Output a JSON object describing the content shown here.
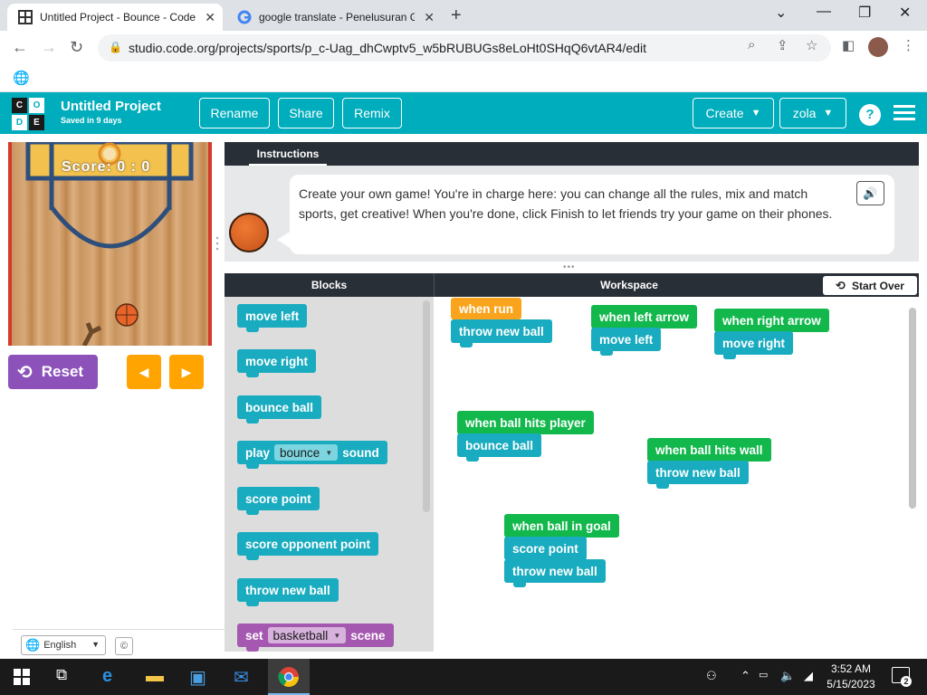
{
  "browser": {
    "tabs": [
      {
        "title": "Untitled Project - Bounce - Code",
        "close": "✕"
      },
      {
        "title": "google translate - Penelusuran G",
        "close": "✕"
      }
    ],
    "new_tab": "+",
    "window_controls": {
      "dropdown": "⌄",
      "minimize": "—",
      "restore": "❐",
      "close": "✕"
    },
    "url": "studio.code.org/projects/sports/p_c-Uag_dhCwptv5_w5bRUBUGs8eLoHt0SHqQ6vtAR4/edit"
  },
  "header": {
    "logo_letters": [
      "C",
      "O",
      "D",
      "E"
    ],
    "project_name": "Untitled Project",
    "saved_status": "Saved in 9 days",
    "rename_label": "Rename",
    "share_label": "Share",
    "remix_label": "Remix",
    "create_label": "Create",
    "user_label": "zola",
    "help_label": "?"
  },
  "game": {
    "score_text": "Score: 0 : 0",
    "reset_label": "Reset",
    "left_arrow": "◀",
    "right_arrow": "▶"
  },
  "footer": {
    "language": "English",
    "copyright": "©"
  },
  "instructions": {
    "tab_label": "Instructions",
    "text": "Create your own game! You're in charge here: you can change all the rules, mix and match sports, get creative! When you're done, click Finish to let friends try your game on their phones."
  },
  "panels": {
    "blocks_label": "Blocks",
    "workspace_label": "Workspace",
    "start_over_label": "Start Over"
  },
  "toolbox": {
    "move_left": "move left",
    "move_right": "move right",
    "bounce_ball": "bounce ball",
    "play_prefix": "play",
    "play_sound_value": "bounce",
    "play_suffix": "sound",
    "score_point": "score point",
    "score_opponent_point": "score opponent point",
    "throw_new_ball": "throw new ball",
    "set_prefix": "set",
    "set_scene_value": "basketball",
    "set_suffix": "scene"
  },
  "workspace": {
    "when_run": {
      "event": "when run",
      "action": "throw new ball"
    },
    "when_left_arrow": {
      "event": "when left arrow",
      "action": "move left"
    },
    "when_right_arrow": {
      "event": "when right arrow",
      "action": "move right"
    },
    "when_ball_hits_player": {
      "event": "when ball hits player",
      "action": "bounce ball"
    },
    "when_ball_hits_wall": {
      "event": "when ball hits wall",
      "action": "throw new ball"
    },
    "when_ball_in_goal": {
      "event": "when ball in goal",
      "actions": [
        "score point",
        "throw new ball"
      ]
    }
  },
  "taskbar": {
    "time": "3:52 AM",
    "date": "5/15/2023",
    "notification_count": "2"
  },
  "colors": {
    "header_teal": "#00adbc",
    "block_teal": "#19abbf",
    "event_green": "#12b84c",
    "run_orange": "#f9a41c",
    "reset_purple": "#8c52ba",
    "arrow_orange": "#ffa400",
    "set_purple": "#a558b0"
  }
}
